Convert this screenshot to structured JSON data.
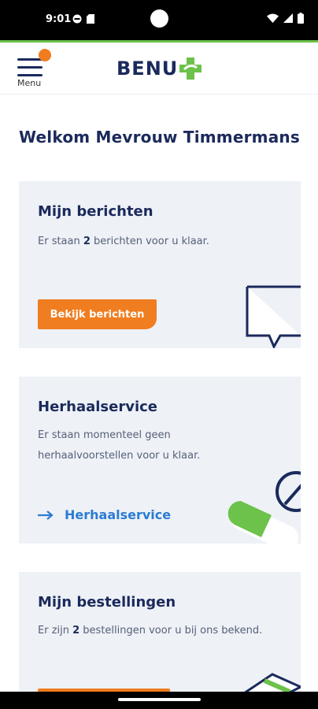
{
  "status_bar": {
    "time": "9:01"
  },
  "header": {
    "menu_label": "Menu",
    "logo_text": "BENU",
    "accent_orange": "#f07d1f",
    "brand_green": "#6cc24a",
    "brand_navy": "#1b2a5c"
  },
  "welcome": "Welkom Mevrouw Timmermans",
  "cards": {
    "messages": {
      "title": "Mijn berichten",
      "text_before": "Er staan ",
      "count": "2",
      "text_after": " berichten voor u klaar.",
      "button": "Bekijk berichten",
      "icon": "speech-bubble-icon"
    },
    "refill": {
      "title": "Herhaalservice",
      "text_line1": "Er staan momenteel geen",
      "text_line2": "herhaalvoorstellen voor u klaar.",
      "link": "Herhaalservice",
      "icon": "pill-icon"
    },
    "orders": {
      "title": "Mijn bestellingen",
      "text_before": "Er zijn ",
      "count": "2",
      "text_after": " bestellingen voor u bij ons bekend.",
      "icon": "package-icon"
    }
  }
}
